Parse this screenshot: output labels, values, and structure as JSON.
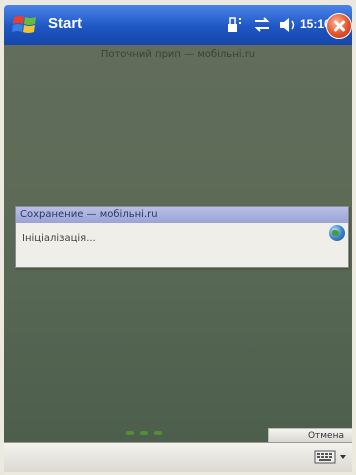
{
  "titlebar": {
    "start_label": "Start",
    "clock": "15:16",
    "icons": [
      "windows-flag-icon",
      "connectivity-icon",
      "sync-icon",
      "volume-icon",
      "close-icon"
    ]
  },
  "content": {
    "caption": "Поточний прип — мобільні.ru"
  },
  "dialog": {
    "title": "Сохранение — мобільні.ru",
    "text": "Ініціалізація...",
    "icon": "globe-icon"
  },
  "softkeys": {
    "right": "Отмена"
  },
  "menubar": {
    "icons": [
      "keyboard-icon",
      "sip-arrow-icon"
    ]
  },
  "colors": {
    "titlebar": "#1e56c4",
    "content_bg": "#5d6b57",
    "dialog_title": "#9aa3d9"
  }
}
